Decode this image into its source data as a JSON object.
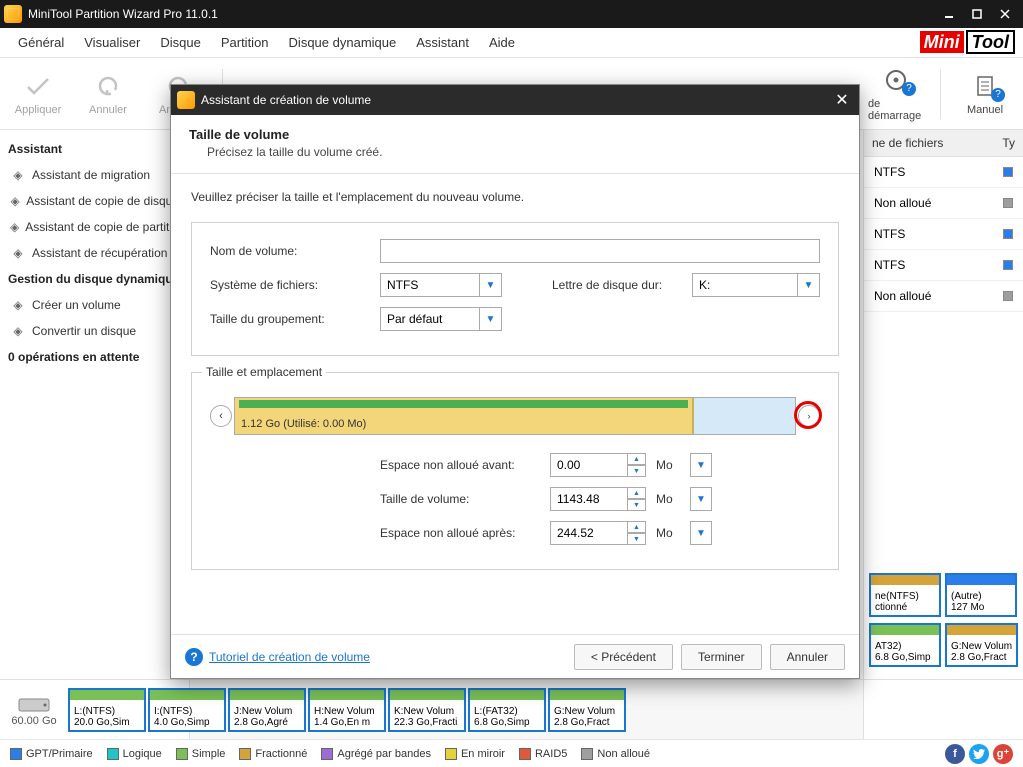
{
  "app": {
    "title": "MiniTool Partition Wizard Pro 11.0.1",
    "brand_mini": "Mini",
    "brand_tool": "Tool"
  },
  "menu": {
    "items": [
      "Général",
      "Visualiser",
      "Disque",
      "Partition",
      "Disque dynamique",
      "Assistant",
      "Aide"
    ]
  },
  "toolbar": {
    "apply": "Appliquer",
    "undo": "Annuler",
    "cancel": "Annuler",
    "boot_media": "de démarrage",
    "manual": "Manuel"
  },
  "left": {
    "section1": "Assistant",
    "items1": [
      "Assistant de migration",
      "Assistant de copie de disque",
      "Assistant de copie de partition",
      "Assistant de récupération"
    ],
    "section2": "Gestion du disque dynamique",
    "items2": [
      "Créer un volume",
      "Convertir un disque"
    ],
    "pending": "0 opérations en attente"
  },
  "right": {
    "col_fs": "ne de fichiers",
    "col_type": "Ty",
    "rows": [
      {
        "fs": "NTFS",
        "color": "#2b7de9"
      },
      {
        "fs": "Non alloué",
        "color": "#9e9e9e"
      },
      {
        "fs": "NTFS",
        "color": "#2b7de9"
      },
      {
        "fs": "NTFS",
        "color": "#2b7de9"
      },
      {
        "fs": "Non alloué",
        "color": "#9e9e9e"
      }
    ]
  },
  "parts": [
    {
      "label1": "ne(NTFS)",
      "label2": "ctionné",
      "bar": "#d4a33a"
    },
    {
      "label1": "(Autre)",
      "label2": "127 Mo",
      "bar": "#2b7de9"
    },
    {
      "label1": "AT32)",
      "label2": "6.8 Go,Simp",
      "bar": "#7ac057"
    },
    {
      "label1": "G:New Volum",
      "label2": "2.8 Go,Fract",
      "bar": "#d4a33a"
    }
  ],
  "diskstrip": {
    "size": "60.00 Go",
    "items": [
      {
        "l1": "L:(NTFS)",
        "l2": "20.0 Go,Sim"
      },
      {
        "l1": "I:(NTFS)",
        "l2": "4.0 Go,Simp"
      },
      {
        "l1": "J:New Volum",
        "l2": "2.8 Go,Agré"
      },
      {
        "l1": "H:New Volum",
        "l2": "1.4 Go,En m"
      },
      {
        "l1": "K:New Volum",
        "l2": "22.3 Go,Fracti"
      },
      {
        "l1": "L:(FAT32)",
        "l2": "6.8 Go,Simp"
      },
      {
        "l1": "G:New Volum",
        "l2": "2.8 Go,Fract"
      }
    ]
  },
  "legend": {
    "items": [
      {
        "label": "GPT/Primaire",
        "color": "#2b7de9"
      },
      {
        "label": "Logique",
        "color": "#20c5c5"
      },
      {
        "label": "Simple",
        "color": "#7ac057"
      },
      {
        "label": "Fractionné",
        "color": "#d4a33a"
      },
      {
        "label": "Agrégé par bandes",
        "color": "#9c6cd4"
      },
      {
        "label": "En miroir",
        "color": "#e4d23a"
      },
      {
        "label": "RAID5",
        "color": "#e05a3a"
      },
      {
        "label": "Non alloué",
        "color": "#9e9e9e"
      }
    ]
  },
  "dialog": {
    "title": "Assistant de création de volume",
    "header": "Taille de volume",
    "subheader": "Précisez la taille du volume créé.",
    "instruction": "Veuillez préciser la taille et l'emplacement du nouveau volume.",
    "fields": {
      "volume_name_label": "Nom de volume:",
      "volume_name_value": "",
      "fs_label": "Système de fichiers:",
      "fs_value": "NTFS",
      "drive_letter_label": "Lettre de disque dur:",
      "drive_letter_value": "K:",
      "cluster_label": "Taille du groupement:",
      "cluster_value": "Par défaut"
    },
    "size_section": {
      "legend": "Taille et emplacement",
      "alloc_text": "1.12 Go (Utilisé: 0.00 Mo)",
      "alloc_percent": 82
    },
    "spinrows": {
      "before_label": "Espace non alloué avant:",
      "before_value": "0.00",
      "size_label": "Taille de volume:",
      "size_value": "1143.48",
      "after_label": "Espace non alloué après:",
      "after_value": "244.52",
      "unit": "Mo"
    },
    "footer": {
      "tutorial": "Tutoriel de création de volume",
      "prev": "< Précédent",
      "finish": "Terminer",
      "cancel": "Annuler"
    }
  }
}
